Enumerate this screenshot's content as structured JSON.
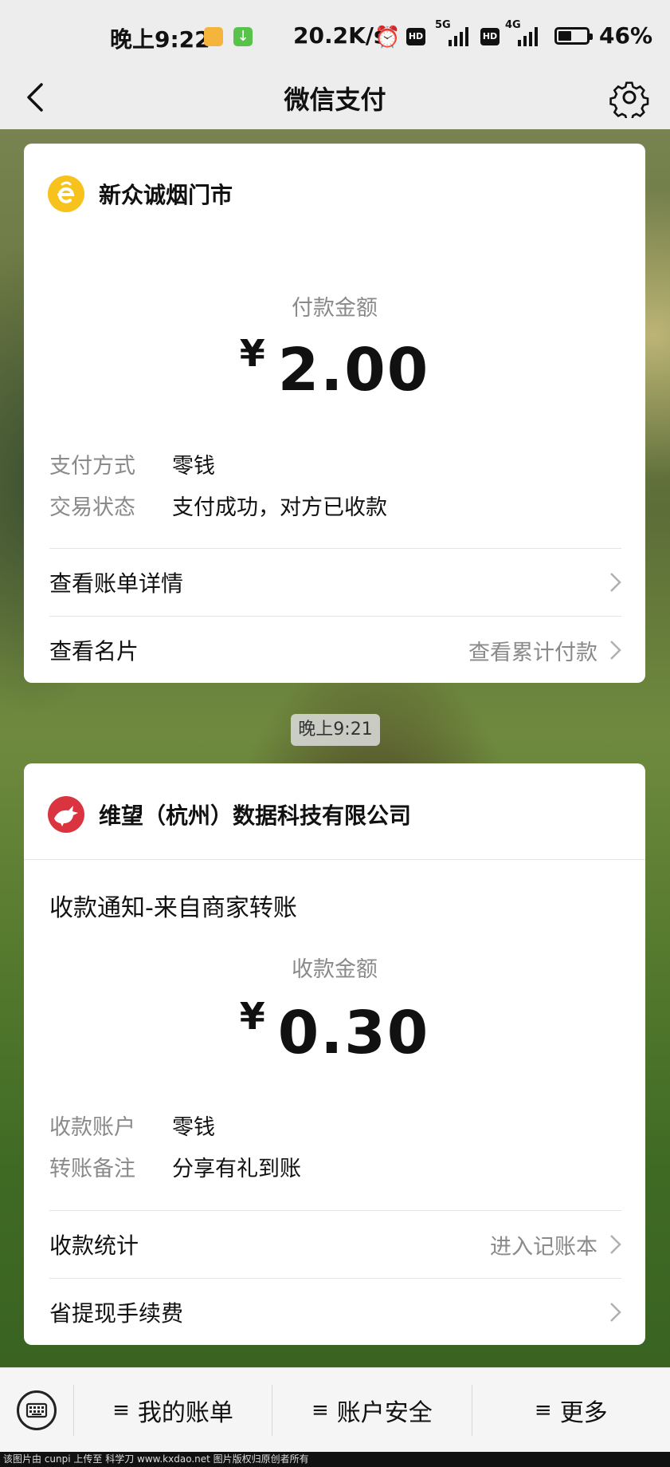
{
  "status_bar": {
    "time": "晚上9:22",
    "network_speed": "20.2K/s",
    "hd_label": "HD",
    "sim1_tech": "5G",
    "sim2_tech": "4G",
    "battery_percent": "46%",
    "battery_level": 0.46
  },
  "nav": {
    "title": "微信支付",
    "back_icon": "chevron-left-icon",
    "settings_icon": "gear-icon"
  },
  "payment_card": {
    "merchant_name": "新众诚烟门市",
    "amount_label": "付款金额",
    "currency": "¥",
    "amount": "2.00",
    "details": [
      {
        "key": "支付方式",
        "value": "零钱"
      },
      {
        "key": "交易状态",
        "value": "支付成功，对方已收款"
      }
    ],
    "links": [
      {
        "label": "查看账单详情",
        "right": ""
      },
      {
        "label": "查看名片",
        "right": "查看累计付款"
      }
    ]
  },
  "timestamp": "晚上9:21",
  "receipt_card": {
    "merchant_name": "维望（杭州）数据科技有限公司",
    "notice_title": "收款通知-来自商家转账",
    "amount_label": "收款金额",
    "currency": "¥",
    "amount": "0.30",
    "details": [
      {
        "key": "收款账户",
        "value": "零钱"
      },
      {
        "key": "转账备注",
        "value": "分享有礼到账"
      }
    ],
    "links": [
      {
        "label": "收款统计",
        "right": "进入记账本"
      },
      {
        "label": "省提现手续费",
        "right": ""
      }
    ]
  },
  "bottom_bar": {
    "keyboard_icon": "keyboard-icon",
    "items": [
      {
        "icon": "≡",
        "label": "我的账单"
      },
      {
        "icon": "≡",
        "label": "账户安全"
      },
      {
        "icon": "≡",
        "label": "更多"
      }
    ]
  },
  "footer_text": "该图片由 cunpi 上传至 科学刀 www.kxdao.net 图片版权归原创者所有",
  "colors": {
    "merchant1_logo": "#f7c21b",
    "merchant2_logo": "#d9343f",
    "nav_bg": "#ededed"
  }
}
